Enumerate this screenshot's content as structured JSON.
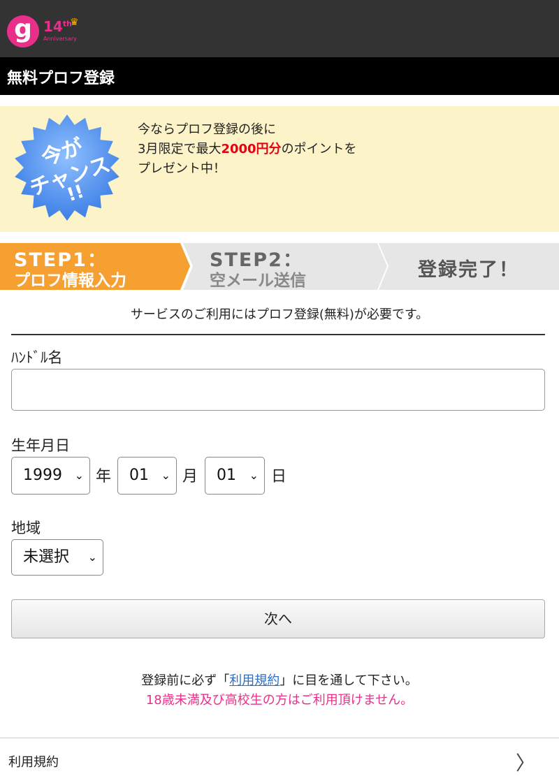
{
  "header": {
    "logo_letter": "g",
    "logo_number": "14",
    "logo_suffix": "th",
    "logo_sub": "Anniversary"
  },
  "page_title": "無料プロフ登録",
  "banner": {
    "badge": {
      "line1": "今が",
      "line2": "チャンス",
      "line3": "!!"
    },
    "text_line1": "今ならプロフ登録の後に",
    "text_line2_pre": "3月限定で最大",
    "text_line2_highlight": "2000円分",
    "text_line2_post": "のポイントを",
    "text_line3": "プレゼント中！",
    "badge_color": "#5b95f0",
    "highlight_color": "#e60012"
  },
  "steps": {
    "step1_title": "STEP1：",
    "step1_sub": "プロフ情報入力",
    "step2_title": "STEP2：",
    "step2_sub": "空メール送信",
    "step3_title": "登録完了！",
    "active_color": "#f7a032"
  },
  "notice": "サービスのご利用にはプロフ登録(無料)が必要です。",
  "form": {
    "handle_label": "ﾊﾝﾄﾞﾙ名",
    "handle_value": "",
    "birthday_label": "生年月日",
    "year_value": "1999",
    "year_unit": "年",
    "month_value": "01",
    "month_unit": "月",
    "day_value": "01",
    "day_unit": "日",
    "region_label": "地域",
    "region_value": "未選択",
    "next_button": "次へ"
  },
  "terms": {
    "pre": "登録前に必ず「",
    "link": "利用規約",
    "post": "」に目を通して下さい。",
    "age_warning": "18歳未満及び高校生の方はご利用頂けません。"
  },
  "footer": {
    "terms_item": "利用規約",
    "chevron": "〉"
  }
}
